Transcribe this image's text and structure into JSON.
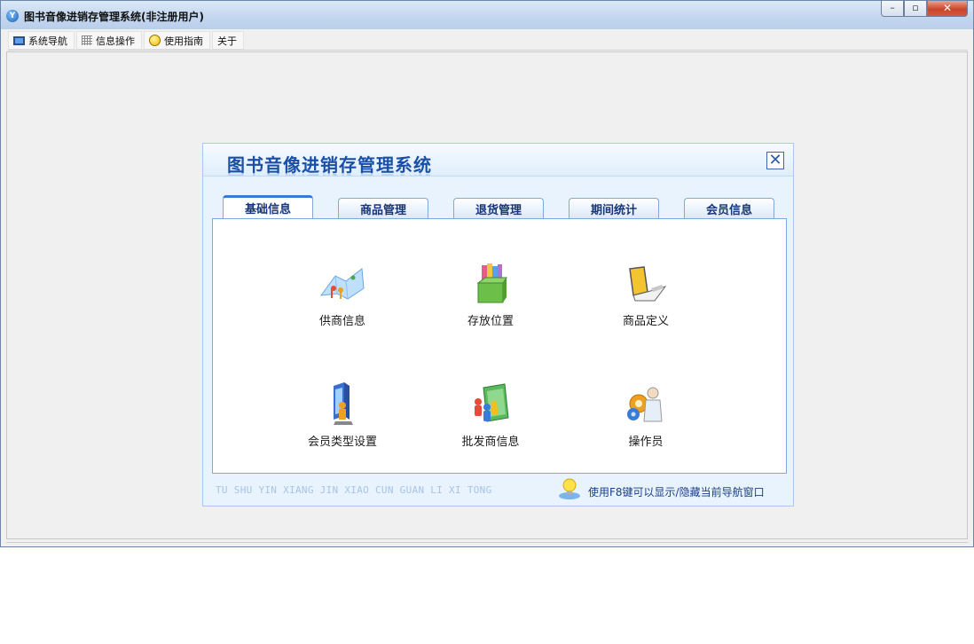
{
  "window": {
    "title": "图书音像进销存管理系统(非注册用户)",
    "controls": {
      "minimize": "–",
      "restore": "▫",
      "close": "✕"
    }
  },
  "menu": [
    {
      "label": "系统导航",
      "icon": "monitor-icon"
    },
    {
      "label": "信息操作",
      "icon": "grid-icon"
    },
    {
      "label": "使用指南",
      "icon": "smiley-icon"
    },
    {
      "label": "关于",
      "icon": ""
    }
  ],
  "nav": {
    "title": "图书音像进销存管理系统",
    "close_glyph": "✕",
    "tabs": [
      {
        "label": "基础信息",
        "active": true
      },
      {
        "label": "商品管理",
        "active": false
      },
      {
        "label": "退货管理",
        "active": false
      },
      {
        "label": "期间统计",
        "active": false
      },
      {
        "label": "会员信息",
        "active": false
      }
    ],
    "items": [
      {
        "label": "供商信息",
        "icon": "supplier-map-icon"
      },
      {
        "label": "存放位置",
        "icon": "storage-box-icon"
      },
      {
        "label": "商品定义",
        "icon": "product-laptop-icon"
      },
      {
        "label": "会员类型设置",
        "icon": "member-type-icon"
      },
      {
        "label": "批发商信息",
        "icon": "wholesaler-folder-icon"
      },
      {
        "label": "操作员",
        "icon": "operator-icon"
      }
    ],
    "footer_pinyin": "TU SHU YIN XIANG JIN XIAO CUN GUAN LI XI TONG",
    "footer_tip": "使用F8键可以显示/隐藏当前导航窗口"
  },
  "colors": {
    "title_blue": "#1a4fa8",
    "tab_border": "#7fa9dc",
    "active_tab_accent": "#3a78d6",
    "panel_bg": "#e9f3fd"
  }
}
